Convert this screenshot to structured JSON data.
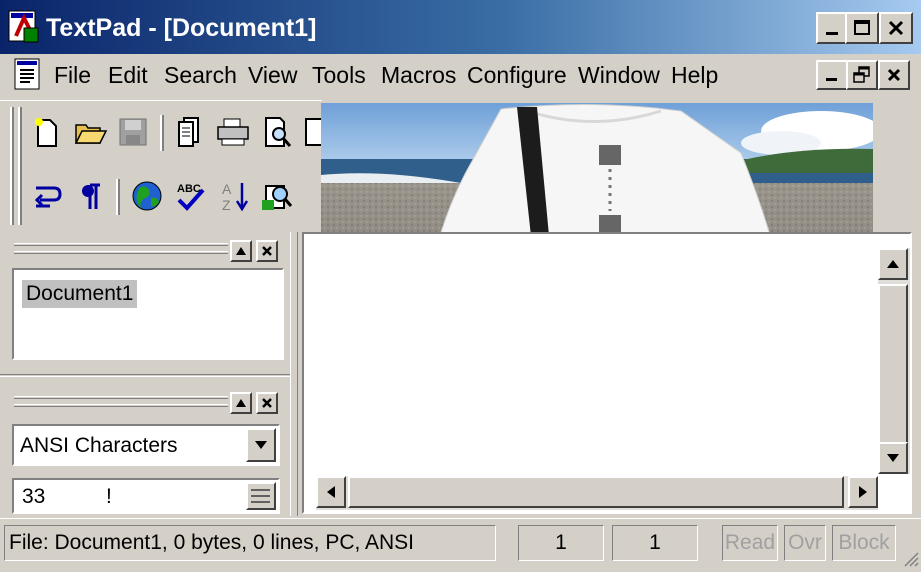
{
  "window": {
    "title": "TextPad - [Document1]"
  },
  "menu": {
    "items": [
      "File",
      "Edit",
      "Search",
      "View",
      "Tools",
      "Macros",
      "Configure",
      "Window",
      "Help"
    ]
  },
  "document_selector": {
    "items": [
      "Document1"
    ]
  },
  "clip_library": {
    "charset": "ANSI Characters",
    "char_code": "33",
    "char_glyph": "!"
  },
  "statusbar": {
    "file_info": "File: Document1, 0 bytes, 0 lines, PC, ANSI",
    "line": "1",
    "column": "1",
    "read": "Read",
    "ovr": "Ovr",
    "block": "Block"
  },
  "colors": {
    "title_start": "#0a246a",
    "title_end": "#a6caf0",
    "face": "#d4d0c8"
  },
  "icons": {
    "toolbar": [
      "new-icon",
      "open-icon",
      "save-icon",
      "save-all-icon",
      "print-icon",
      "print-preview-icon",
      "word-wrap-icon",
      "show-symbols-icon",
      "web-browser-icon",
      "spelling-icon",
      "sort-icon",
      "find-in-files-icon"
    ]
  }
}
